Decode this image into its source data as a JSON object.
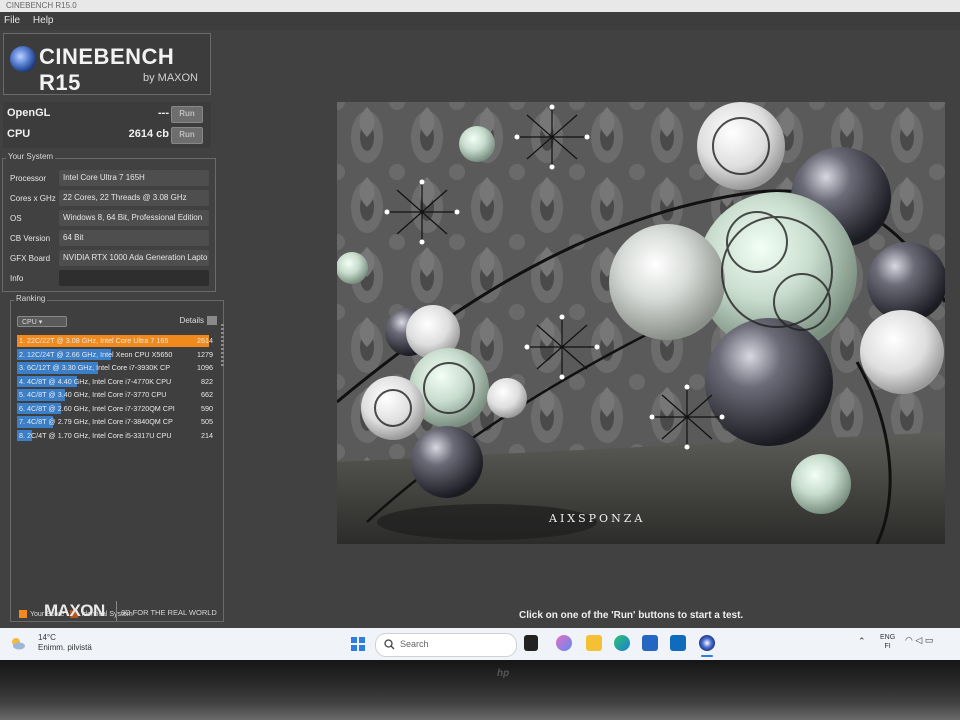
{
  "window": {
    "title": "CINEBENCH R15.0"
  },
  "menu": {
    "items": [
      "File",
      "Help"
    ]
  },
  "logo": {
    "name": "CINEBENCH R15",
    "by": "by MAXON"
  },
  "benchmarks": [
    {
      "label": "OpenGL",
      "value": "---",
      "button": "Run"
    },
    {
      "label": "CPU",
      "value": "2614 cb",
      "button": "Run"
    }
  ],
  "system": {
    "title": "Your System",
    "rows": [
      {
        "key": "Processor",
        "value": "Intel Core Ultra 7 165H"
      },
      {
        "key": "Cores x GHz",
        "value": "22 Cores, 22 Threads @ 3.08 GHz"
      },
      {
        "key": "OS",
        "value": "Windows 8, 64 Bit, Professional Edition"
      },
      {
        "key": "CB Version",
        "value": "64 Bit"
      },
      {
        "key": "GFX Board",
        "value": "NVIDIA RTX 1000 Ada Generation Lapto"
      },
      {
        "key": "Info",
        "value": ""
      }
    ]
  },
  "ranking": {
    "title": "Ranking",
    "filter": "CPU",
    "details": "Details",
    "rows": [
      {
        "label": "1. 22C/22T @ 3.08 GHz, Intel Core Ultra 7 165",
        "score": "2614",
        "fraction": 1.0,
        "color": "#f08a1c"
      },
      {
        "label": "2. 12C/24T @ 2.66 GHz, Intel Xeon CPU X5650",
        "score": "1279",
        "fraction": 0.49,
        "color": "#3a7fc7"
      },
      {
        "label": "3. 6C/12T @ 3.30 GHz,  Intel Core i7-3930K CP",
        "score": "1096",
        "fraction": 0.42,
        "color": "#3a7fc7"
      },
      {
        "label": "4. 4C/8T @ 4.40 GHz, Intel Core i7-4770K CPU",
        "score": "822",
        "fraction": 0.31,
        "color": "#3a7fc7"
      },
      {
        "label": "5. 4C/8T @ 3.40 GHz,  Intel Core i7-3770 CPU",
        "score": "662",
        "fraction": 0.25,
        "color": "#3a7fc7"
      },
      {
        "label": "6. 4C/8T @ 2.60 GHz, Intel Core i7-3720QM CPI",
        "score": "590",
        "fraction": 0.23,
        "color": "#3a7fc7"
      },
      {
        "label": "7. 4C/8T @ 2.79 GHz,  Intel Core i7-3840QM CP",
        "score": "505",
        "fraction": 0.19,
        "color": "#3a7fc7"
      },
      {
        "label": "8. 2C/4T @ 1.70 GHz,  Intel Core i5-3317U CPU",
        "score": "214",
        "fraction": 0.08,
        "color": "#3a7fc7"
      }
    ],
    "legend": [
      {
        "label": "Your Score",
        "color": "#f08a1c"
      },
      {
        "label": "Identical System",
        "color": "#b5561e"
      }
    ]
  },
  "footer": {
    "brand": "MAXON",
    "tagline": "3D FOR THE REAL WORLD"
  },
  "render": {
    "watermark": "AIXSPONZA"
  },
  "status": {
    "text": "Click on one of the 'Run' buttons to start a test."
  },
  "taskbar": {
    "temp": "14°C",
    "weather": "Enimm. pilvistä",
    "search_placeholder": "Search",
    "lang": "ENG",
    "region": "FI"
  }
}
